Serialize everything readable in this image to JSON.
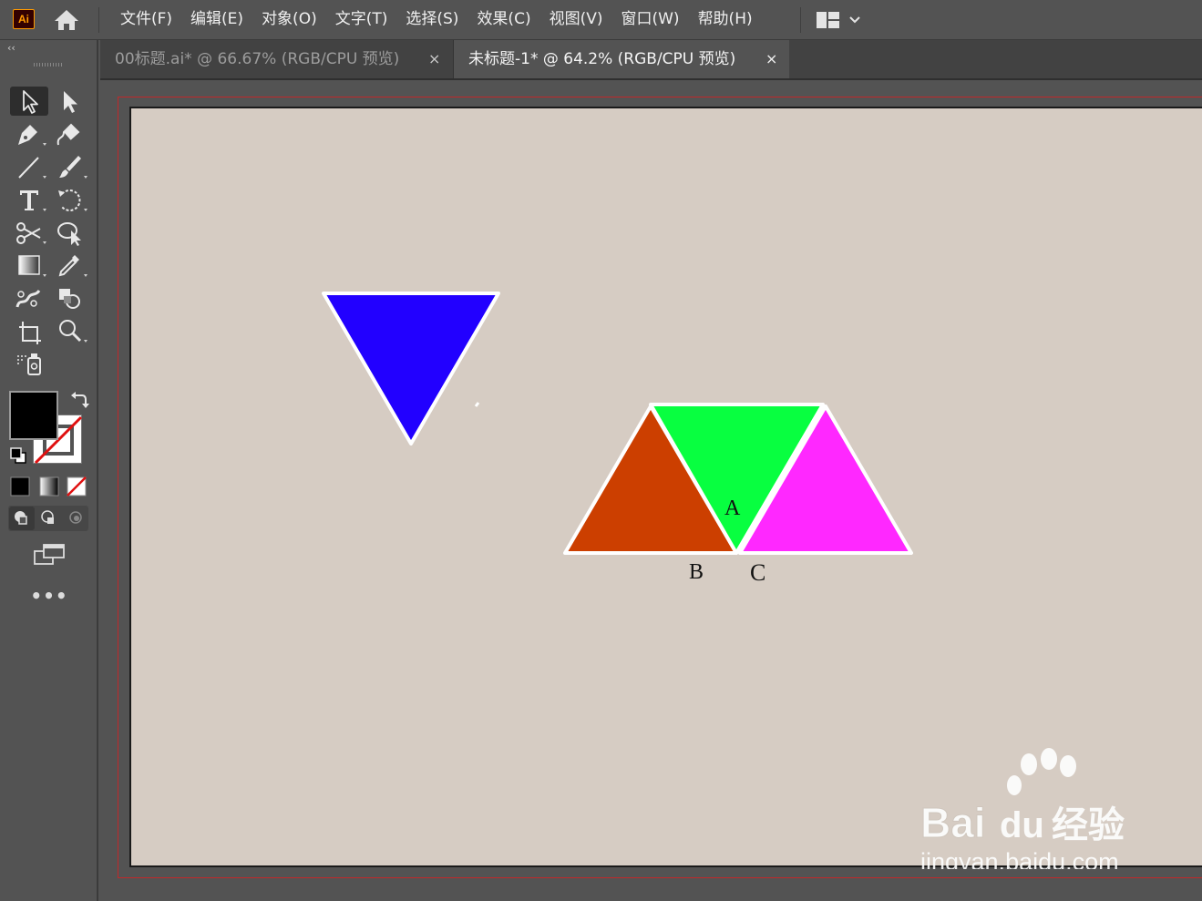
{
  "app": {
    "logo_text": "Ai",
    "menu": [
      {
        "label": "文件(F)"
      },
      {
        "label": "编辑(E)"
      },
      {
        "label": "对象(O)"
      },
      {
        "label": "文字(T)"
      },
      {
        "label": "选择(S)"
      },
      {
        "label": "效果(C)"
      },
      {
        "label": "视图(V)"
      },
      {
        "label": "窗口(W)"
      },
      {
        "label": "帮助(H)"
      }
    ]
  },
  "tabs": [
    {
      "label": "00标题.ai* @ 66.67% (RGB/CPU 预览)",
      "close": "×",
      "active": false
    },
    {
      "label": "未标题-1* @ 64.2% (RGB/CPU 预览)",
      "close": "×",
      "active": true
    }
  ],
  "toolbar": {
    "collapse_label": "‹‹",
    "more_label": "•••",
    "tools": [
      "selection-tool",
      "direct-selection-tool",
      "pen-tool",
      "curvature-tool",
      "line-segment-tool",
      "paintbrush-tool",
      "type-tool",
      "rotate-tool",
      "scissors-tool",
      "shape-builder-tool",
      "gradient-tool",
      "eyedropper-tool",
      "puppet-warp-tool",
      "live-paint-tool",
      "artboard-tool",
      "zoom-tool",
      "symbol-sprayer-tool"
    ],
    "fill_color": "#000000",
    "stroke_color": "none"
  },
  "canvas": {
    "artboard_color": "#d6ccc3",
    "bleed_color": "#c0282a",
    "shapes": [
      {
        "name": "blue-triangle",
        "color": "#2200ff",
        "stroke": "#ffffff"
      },
      {
        "name": "orange-triangle",
        "color": "#cc3f00",
        "stroke": "#ffffff"
      },
      {
        "name": "green-triangle",
        "color": "#08ff40",
        "stroke": "#ffffff"
      },
      {
        "name": "magenta-triangle",
        "color": "#ff28ff",
        "stroke": "#ffffff"
      }
    ],
    "labels": {
      "a": "A",
      "b": "B",
      "c": "C"
    }
  },
  "watermark": {
    "brand": "Bai",
    "brand2": "du",
    "brand_cn": "经验",
    "url": "jingyan.baidu.com"
  }
}
